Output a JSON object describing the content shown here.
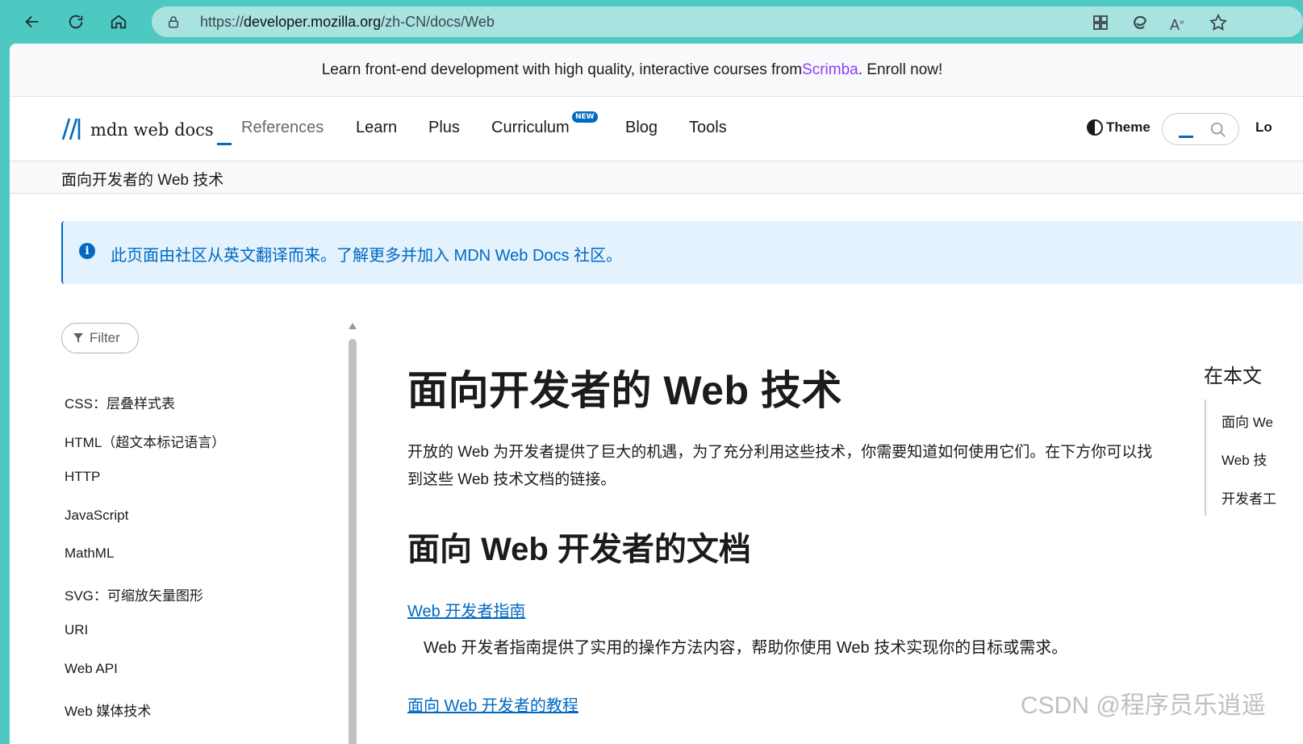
{
  "browser": {
    "url_prefix": "https://",
    "url_host": "developer.mozilla.org",
    "url_path": "/zh-CN/docs/Web",
    "icons": [
      "back-arrow-icon",
      "refresh-icon",
      "home-icon",
      "lock-icon",
      "apps-icon",
      "edge-copilot-icon",
      "read-aloud-icon",
      "favorite-star-icon"
    ]
  },
  "banner": {
    "prefix": "Learn front-end development with high quality, interactive courses from ",
    "link": "Scrimba",
    "suffix": ". Enroll now!"
  },
  "header": {
    "logo_text": "mdn web docs",
    "nav": [
      "References",
      "Learn",
      "Plus",
      "Curriculum",
      "Blog",
      "Tools"
    ],
    "new_badge": "NEW",
    "theme": "Theme",
    "login_partial": "Lo"
  },
  "breadcrumb": "面向开发者的 Web 技术",
  "notice": {
    "icon": "i",
    "text": "此页面由社区从英文翻译而来。了解更多并加入 MDN Web Docs 社区。"
  },
  "sidebar": {
    "filter": "Filter",
    "items": [
      "CSS：层叠样式表",
      "HTML（超文本标记语言）",
      "HTTP",
      "JavaScript",
      "MathML",
      "SVG：可缩放矢量图形",
      "URI",
      "Web API",
      "Web 媒体技术"
    ]
  },
  "main": {
    "title": "面向开发者的 Web 技术",
    "intro": "开放的 Web 为开发者提供了巨大的机遇，为了充分利用这些技术，你需要知道如何使用它们。在下方你可以找到这些 Web 技术文档的链接。",
    "h2": "面向 Web 开发者的文档",
    "link1": "Web 开发者指南",
    "link1_desc": "Web 开发者指南提供了实用的操作方法内容，帮助你使用 Web 技术实现你的目标或需求。",
    "link2": "面向 Web 开发者的教程"
  },
  "toc": {
    "title": "在本文",
    "items": [
      "面向 We",
      "Web 技",
      "开发者工"
    ]
  },
  "watermark": "CSDN @程序员乐逍遥",
  "colors": {
    "accent": "#0069c2",
    "scrimba": "#8b3dff",
    "browser_frame": "#4ec9c2"
  }
}
